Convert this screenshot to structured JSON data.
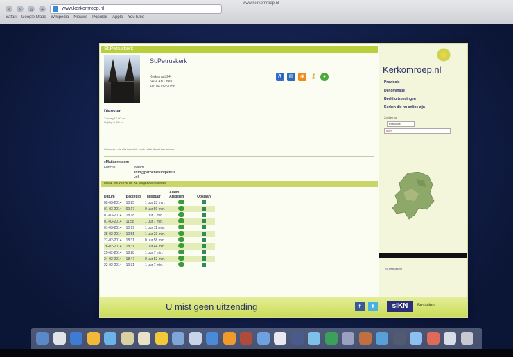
{
  "browser": {
    "url": "www.kerkomroep.nl",
    "window_title": "www.kerkomroep.nl",
    "bookmarks": [
      "Safari",
      "Google Maps",
      "Wikipedia",
      "Nieuws",
      "Populair",
      "Apple",
      "YouTube"
    ]
  },
  "page": {
    "title_bar": "St.Petruskerk",
    "church_name": "St.Petruskerk",
    "address": [
      "Kerkstraat 24",
      "5404 AB Uden",
      "Tel: 0413261156"
    ],
    "diensten_heading": "Diensten",
    "diensten_note": [
      "Zondag 10.00 uur",
      "Vrijdag 9.30 uur"
    ],
    "mid_note": "Wanneer u de site bezoekt, kunt u elke dienst beluisteren",
    "email_heading": "eMailadressen:",
    "email_rows": [
      {
        "label": "Functie",
        "label2": "Naam",
        "value": "info@parochiesintpetrus .nl"
      }
    ],
    "choose_line": "Maak uw keuze uit de volgende diensten",
    "table": {
      "headers": {
        "datum": "Datum",
        "begintijd": "Begintijd",
        "tijdsduur": "Tijdsduur",
        "audio": "Audio Afspelen",
        "opslaan": "Opslaan"
      },
      "rows": [
        {
          "datum": "02-03-2014",
          "begintijd": "10:25",
          "tijdsduur": "1 uur 23 min."
        },
        {
          "datum": "01-03-2014",
          "begintijd": "09:17",
          "tijdsduur": "0 uur 50 min."
        },
        {
          "datum": "01-03-2014",
          "begintijd": "18:18",
          "tijdsduur": "1 uur 7 min."
        },
        {
          "datum": "01-03-2014",
          "begintijd": "11:58",
          "tijdsduur": "1 uur 7 min."
        },
        {
          "datum": "01-03-2014",
          "begintijd": "10:19",
          "tijdsduur": "1 uur 11 min."
        },
        {
          "datum": "28-02-2014",
          "begintijd": "10:51",
          "tijdsduur": "1 uur 23 min."
        },
        {
          "datum": "27-02-2014",
          "begintijd": "18:31",
          "tijdsduur": "0 uur 58 min."
        },
        {
          "datum": "26-02-2014",
          "begintijd": "18:31",
          "tijdsduur": "1 uur 44 min."
        },
        {
          "datum": "25-02-2014",
          "begintijd": "18:28",
          "tijdsduur": "1 uur 7 min."
        },
        {
          "datum": "24-02-2014",
          "begintijd": "18:47",
          "tijdsduur": "0 uur 52 min."
        },
        {
          "datum": "22-02-2014",
          "begintijd": "19:31",
          "tijdsduur": "1 uur 7 min."
        }
      ]
    },
    "footer": {
      "tagline": "U mist geen uitzending",
      "ikn": "sIKN",
      "bestellen": "Bestellen"
    }
  },
  "sidebar": {
    "logo": "Kerkomroep.nl",
    "menu": [
      "Provincie",
      "Denominatie",
      "Beeld uitzendingen",
      "Kerken die nu online zijn"
    ],
    "zoeken_label": "Zoeken op",
    "select_value": "Postcode",
    "search_value": "uden",
    "player_label": "St.Petruskerk"
  },
  "colors": {
    "accent": "#b9cf3c",
    "brand_text": "#2b2f6a",
    "alt_row": "#e4ecb8"
  }
}
